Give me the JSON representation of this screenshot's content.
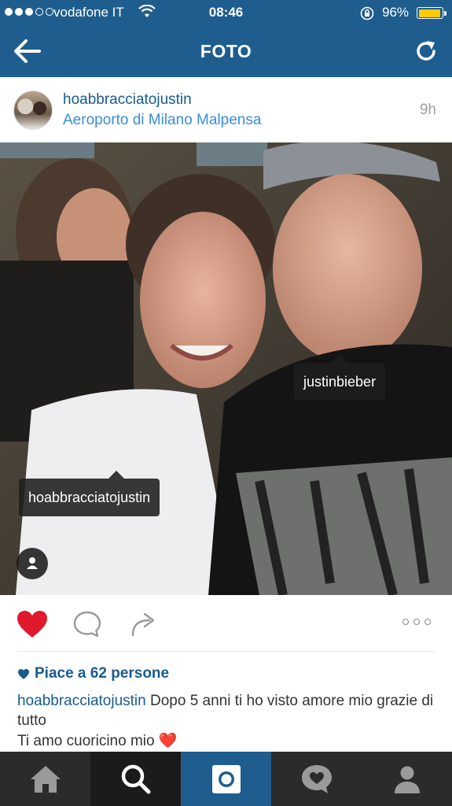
{
  "status_bar": {
    "carrier": "vodafone IT",
    "time": "08:46",
    "battery": "96%",
    "signal_bars_filled": 3,
    "signal_bars_total": 5,
    "battery_level": 0.96
  },
  "nav": {
    "title": "FOTO",
    "back_icon": "arrow-left-icon",
    "refresh_icon": "refresh-icon",
    "color": "#1f5d8e"
  },
  "post": {
    "username": "hoabbracciatojustin",
    "location": "Aeroporto di Milano Malpensa",
    "age": "9h",
    "tags": [
      {
        "label": "justinbieber"
      },
      {
        "label": "hoabbracciatojustin"
      }
    ]
  },
  "actions": {
    "like_icon": "heart-filled-icon",
    "comment_icon": "comment-icon",
    "share_icon": "share-icon",
    "more_icon": "more-dots-icon",
    "like_color": "#e0192c"
  },
  "likes": {
    "text": "Piace a 62 persone"
  },
  "caption": {
    "username": "hoabbracciatojustin",
    "text": " Dopo 5 anni ti ho visto amore mio grazie di tutto",
    "line2": "Ti amo cuoricino mio ",
    "emoji": "❤️"
  },
  "tabbar": {
    "tabs": [
      {
        "name": "home",
        "icon": "home-icon"
      },
      {
        "name": "search",
        "icon": "search-icon"
      },
      {
        "name": "camera",
        "icon": "camera-icon"
      },
      {
        "name": "activity",
        "icon": "activity-heart-icon"
      },
      {
        "name": "profile",
        "icon": "profile-icon"
      }
    ],
    "active_color": "#1f5d8e"
  }
}
